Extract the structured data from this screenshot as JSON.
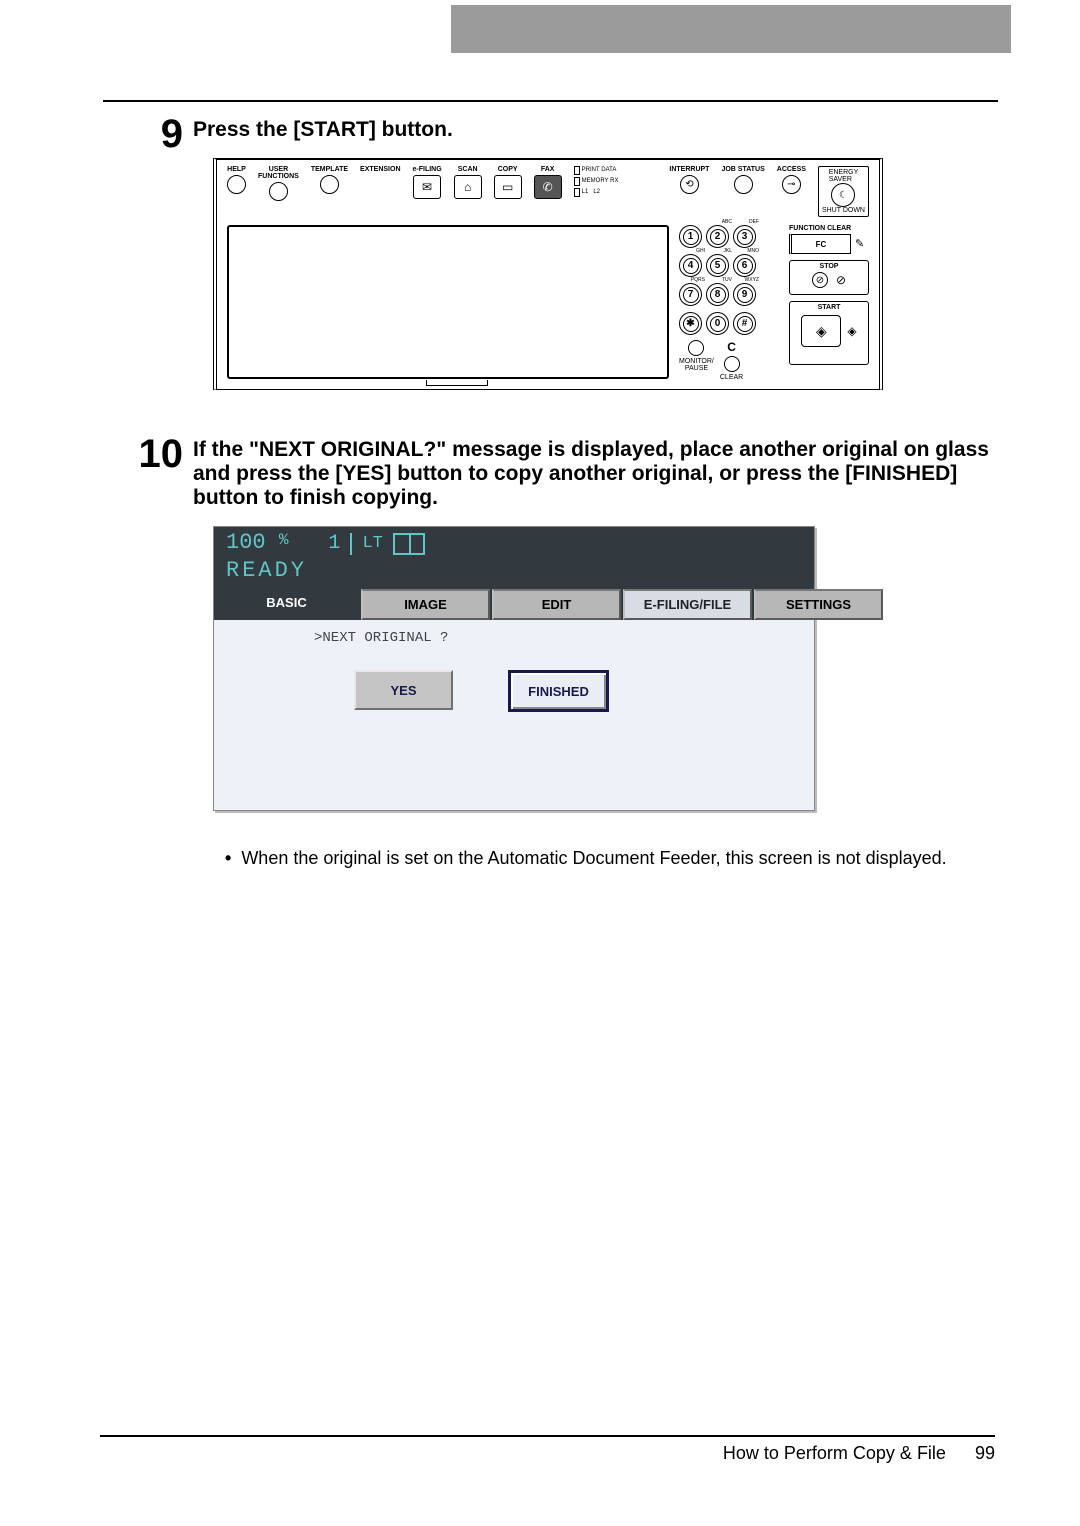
{
  "step9": {
    "num": "9",
    "title": "Press the [START] button.",
    "panel": {
      "help": "HELP",
      "user_functions": "USER\nFUNCTIONS",
      "template": "TEMPLATE",
      "extension": "EXTENSION",
      "efiling": "e-FILING",
      "scan": "SCAN",
      "copy": "COPY",
      "fax": "FAX",
      "print_data": "PRINT DATA",
      "memory_rx": "MEMORY RX",
      "lines": "L1   L2",
      "interrupt": "INTERRUPT",
      "job_status": "JOB STATUS",
      "access": "ACCESS",
      "energy_saver": "ENERGY\nSAVER",
      "shut_down": "SHUT DOWN",
      "function_clear": "FUNCTION CLEAR",
      "fc": "FC",
      "stop": "STOP",
      "start": "START",
      "c": "C",
      "clear": "CLEAR",
      "monitor": "MONITOR/\nPAUSE",
      "keypad": {
        "k1": "1",
        "k2": "2",
        "k3": "3",
        "k4": "4",
        "k5": "5",
        "k6": "6",
        "k7": "7",
        "k8": "8",
        "k9": "9",
        "kstar": "✱",
        "k0": "0",
        "khash": "#",
        "s2": "ABC",
        "s3": "DEF",
        "s4": "GHI",
        "s5": "JKL",
        "s6": "MNO",
        "s7": "PQRS",
        "s8": "TUV",
        "s9": "WXYZ"
      }
    }
  },
  "step10": {
    "num": "10",
    "title": "If the \"NEXT ORIGINAL?\" message is displayed, place another original on glass and press the [YES] button to copy another original, or press the [FINISHED] button to finish copying.",
    "lcd": {
      "zoom": "100",
      "pcnt": "%",
      "count": "1",
      "size": "LT",
      "ready": "READY",
      "tabs": {
        "basic": "BASIC",
        "image": "IMAGE",
        "edit": "EDIT",
        "efile": "E-FILING/FILE",
        "settings": "SETTINGS"
      },
      "prompt": ">NEXT ORIGINAL ?",
      "yes": "YES",
      "finished": "FINISHED"
    },
    "note": "When the original is set on the Automatic Document Feeder, this screen is not displayed."
  },
  "footer": {
    "label": "How to Perform Copy & File",
    "page": "99"
  }
}
